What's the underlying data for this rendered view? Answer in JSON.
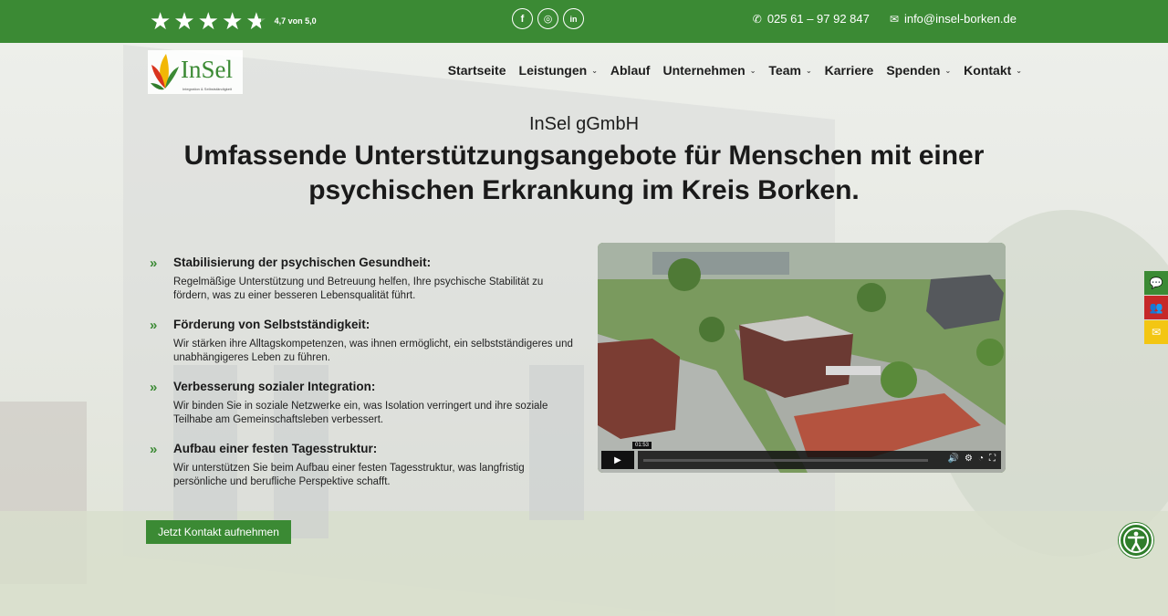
{
  "topbar": {
    "rating_stars": 4.7,
    "rating_text": "4,7 von 5,0",
    "socials": [
      {
        "icon": "facebook-icon",
        "glyph": "f"
      },
      {
        "icon": "instagram-icon",
        "glyph": "◎"
      },
      {
        "icon": "linkedin-icon",
        "glyph": "in"
      }
    ],
    "phone": "025 61 – 97 92 847",
    "email": "info@insel-borken.de"
  },
  "logo": {
    "brand": "InSel",
    "tagline": "Integration & Selbstständigkeit"
  },
  "nav": [
    {
      "label": "Startseite",
      "dropdown": false
    },
    {
      "label": "Leistungen",
      "dropdown": true
    },
    {
      "label": "Ablauf",
      "dropdown": false
    },
    {
      "label": "Unternehmen",
      "dropdown": true
    },
    {
      "label": "Team",
      "dropdown": true
    },
    {
      "label": "Karriere",
      "dropdown": false
    },
    {
      "label": "Spenden",
      "dropdown": true
    },
    {
      "label": "Kontakt",
      "dropdown": true
    }
  ],
  "hero": {
    "eyebrow": "InSel gGmbH",
    "headline": "Umfassende Unterstützungsangebote für Menschen mit einer psychischen Erkrankung im Kreis Borken."
  },
  "benefits": [
    {
      "title": "Stabilisierung der psychischen Gesundheit:",
      "desc": "Regelmäßige Unterstützung und Betreuung helfen, Ihre psychische Stabilität zu fördern, was zu einer besseren Lebensqualität führt."
    },
    {
      "title": "Förderung von Selbstständigkeit:",
      "desc": "Wir stärken ihre Alltagskompetenzen, was ihnen ermöglicht, ein selbstständigeres und unabhängigeres Leben zu führen."
    },
    {
      "title": "Verbesserung sozialer Integration:",
      "desc": "Wir binden Sie in soziale Netzwerke ein, was Isolation verringert und ihre soziale Teilhabe am Gemeinschaftsleben verbessert."
    },
    {
      "title": "Aufbau einer festen Tagesstruktur:",
      "desc": "Wir unterstützen Sie beim Aufbau einer festen Tagesstruktur, was langfristig persönliche und berufliche Perspektive schafft."
    }
  ],
  "cta": {
    "label": "Jetzt Kontakt aufnehmen"
  },
  "video": {
    "time": "01:53",
    "progress": 0.0
  },
  "colors": {
    "brand_green": "#3b8a34",
    "red": "#c62828",
    "yellow": "#f3c613"
  }
}
